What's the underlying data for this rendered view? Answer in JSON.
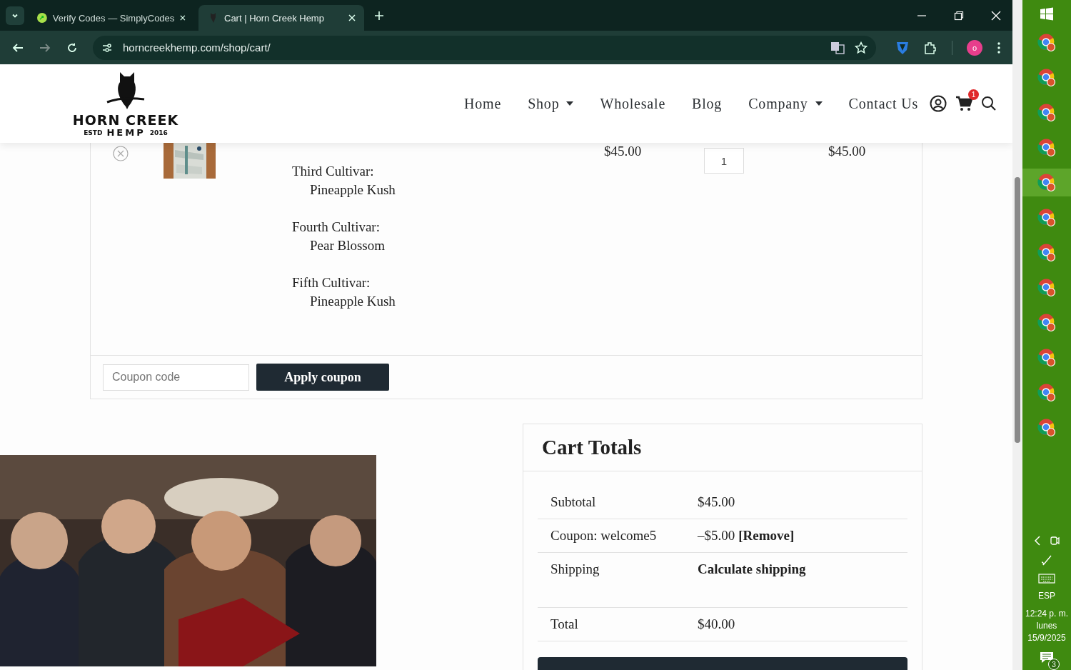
{
  "browser": {
    "tabs": [
      {
        "title": "Verify Codes — SimplyCodes",
        "selected": false
      },
      {
        "title": "Cart | Horn Creek Hemp",
        "selected": true
      }
    ],
    "address": "horncreekhemp.com/shop/cart/",
    "profile_initial": "o"
  },
  "site": {
    "logo": {
      "name": "HORN CREEK",
      "estd": "ESTD",
      "brand": "HEMP",
      "year": "2016"
    },
    "nav": [
      {
        "label": "Home",
        "dropdown": false
      },
      {
        "label": "Shop",
        "dropdown": true
      },
      {
        "label": "Wholesale",
        "dropdown": false
      },
      {
        "label": "Blog",
        "dropdown": false
      },
      {
        "label": "Company",
        "dropdown": true
      },
      {
        "label": "Contact Us",
        "dropdown": false
      }
    ],
    "cart_count": "1"
  },
  "cart_item": {
    "price": "$45.00",
    "quantity": "1",
    "subtotal": "$45.00",
    "options": [
      {
        "label": "Third Cultivar:",
        "value": "Pineapple Kush"
      },
      {
        "label": "Fourth Cultivar:",
        "value": "Pear Blossom"
      },
      {
        "label": "Fifth Cultivar:",
        "value": "Pineapple Kush"
      }
    ]
  },
  "coupon": {
    "placeholder": "Coupon code",
    "button": "Apply coupon"
  },
  "cart_totals": {
    "title": "Cart Totals",
    "rows": [
      {
        "kind": "plain",
        "label": "Subtotal",
        "value": "$45.00"
      },
      {
        "kind": "coupon",
        "label": "Coupon: welcome5",
        "value": "–$5.00",
        "action": "[Remove]"
      },
      {
        "kind": "link",
        "label": "Shipping",
        "value": "Calculate shipping"
      },
      {
        "kind": "plain",
        "label": "Total",
        "value": "$40.00"
      }
    ]
  },
  "taskbar": {
    "apps": [
      {
        "selected": false
      },
      {
        "selected": false
      },
      {
        "selected": false
      },
      {
        "selected": false
      },
      {
        "selected": true
      },
      {
        "selected": false
      },
      {
        "selected": false
      },
      {
        "selected": false
      },
      {
        "selected": false
      },
      {
        "selected": false
      },
      {
        "selected": false
      },
      {
        "selected": false
      }
    ],
    "language": "ESP",
    "time": "12:24 p. m.",
    "day": "lunes",
    "date": "15/9/2025",
    "notifications": "3"
  }
}
